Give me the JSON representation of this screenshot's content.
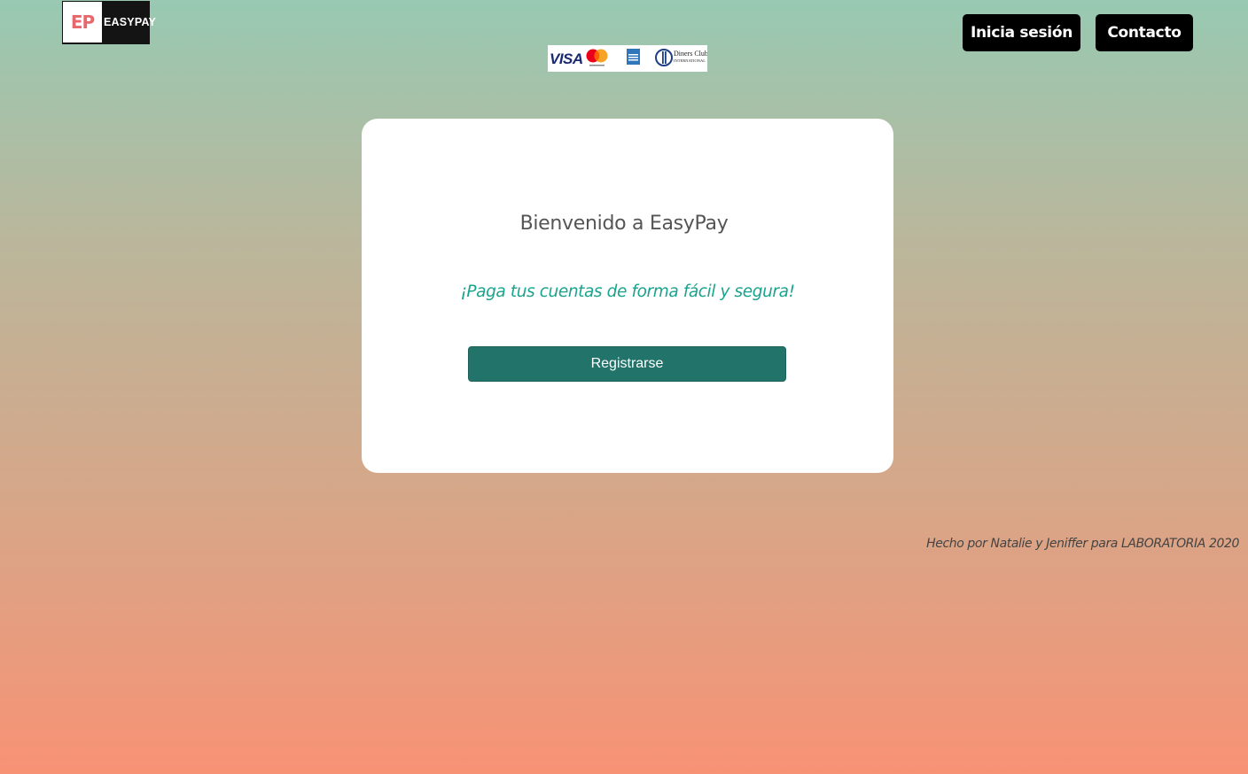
{
  "header": {
    "logo": {
      "mark_text": "EP",
      "word_text": "EASYPAY",
      "mark_color": "#e8676c"
    },
    "card_brands": [
      {
        "name": "VISA",
        "icon": "visa-icon"
      },
      {
        "name": "Mastercard",
        "icon": "mastercard-icon"
      },
      {
        "name": "American Express",
        "icon": "amex-icon"
      },
      {
        "name": "Diners Club International",
        "icon": "diners-club-icon"
      }
    ],
    "nav": {
      "login_label": "Inicia sesión",
      "contact_label": "Contacto"
    }
  },
  "card": {
    "title": "Bienvenido a EasyPay",
    "subtitle": "¡Paga tus cuentas de forma fácil y segura!",
    "register_label": "Registrarse"
  },
  "footer": {
    "credit": "Hecho por Natalie y Jeniffer para LABORATORIA 2020"
  },
  "colors": {
    "gradient_top": "#98c9b2",
    "gradient_bottom": "#f89275",
    "accent_text": "#1aa38d",
    "primary_button": "#22736a",
    "nav_button": "#000000"
  }
}
